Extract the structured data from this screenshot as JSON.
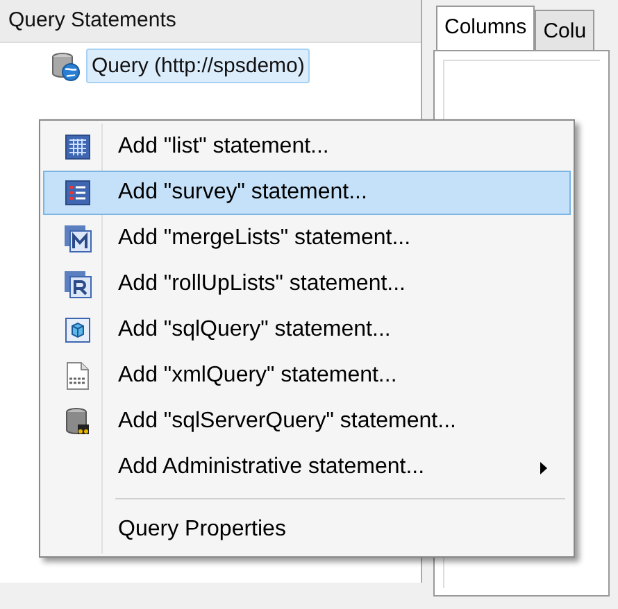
{
  "tree": {
    "header": "Query Statements",
    "items": [
      {
        "label": "Query (http://spsdemo)",
        "selected": true
      }
    ]
  },
  "tabs": [
    {
      "label": "Columns",
      "selected": true
    },
    {
      "label": "Colu",
      "selected": false
    }
  ],
  "context_menu": {
    "items": [
      {
        "kind": "grid",
        "label": "Add \"list\" statement...",
        "selected": false,
        "submenu": false
      },
      {
        "kind": "survey",
        "label": "Add \"survey\" statement...",
        "selected": true,
        "submenu": false
      },
      {
        "kind": "merge",
        "label": "Add \"mergeLists\" statement...",
        "selected": false,
        "submenu": false
      },
      {
        "kind": "rollup",
        "label": "Add \"rollUpLists\" statement...",
        "selected": false,
        "submenu": false
      },
      {
        "kind": "sql",
        "label": "Add \"sqlQuery\" statement...",
        "selected": false,
        "submenu": false
      },
      {
        "kind": "xml",
        "label": "Add \"xmlQuery\" statement...",
        "selected": false,
        "submenu": false
      },
      {
        "kind": "server",
        "label": "Add \"sqlServerQuery\" statement...",
        "selected": false,
        "submenu": false
      },
      {
        "kind": "none",
        "label": "Add Administrative statement...",
        "selected": false,
        "submenu": true
      },
      {
        "kind": "separator"
      },
      {
        "kind": "none",
        "label": "Query Properties",
        "selected": false,
        "submenu": false
      }
    ]
  }
}
